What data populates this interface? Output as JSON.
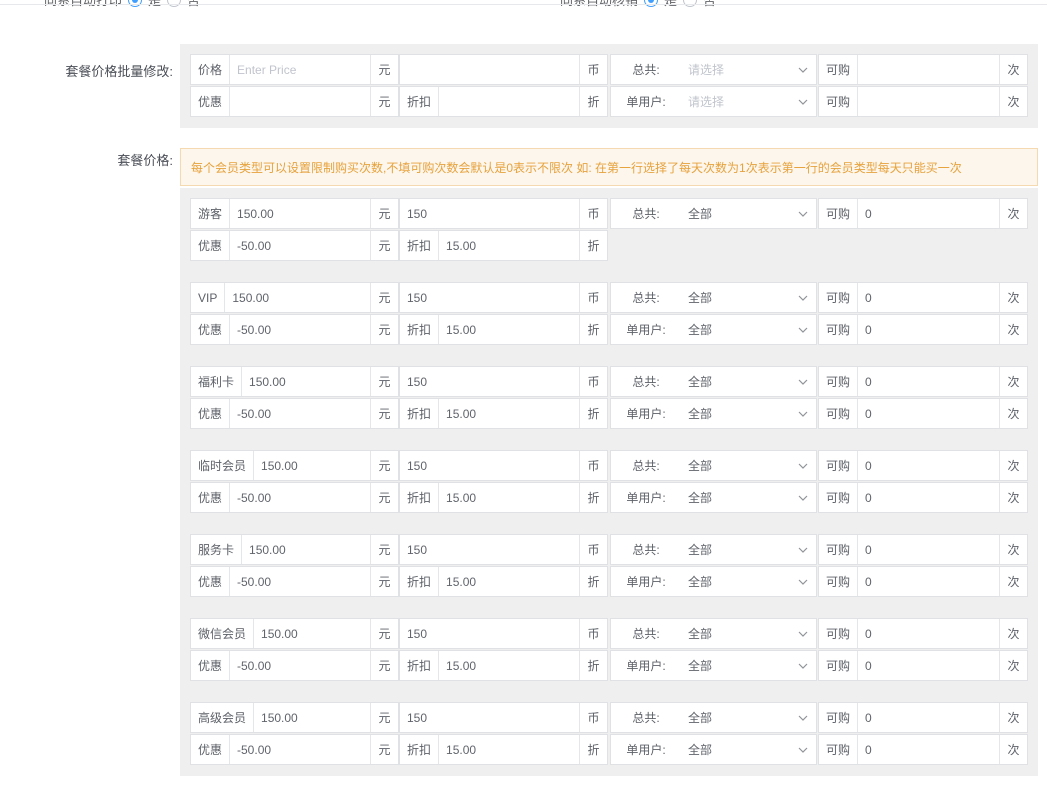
{
  "top": {
    "left_group_label": "同系自动打印",
    "left_yes": "是",
    "left_no": "否",
    "right_group_label": "同系自动核销",
    "right_yes": "是",
    "right_no": "否"
  },
  "batch": {
    "section_label": "套餐价格批量修改:",
    "price_prefix": "价格",
    "price_placeholder": "Enter Price",
    "yuan": "元",
    "coin_value": "",
    "coin_suffix": "币",
    "total_label": "总共:",
    "select_placeholder": "请选择",
    "can_buy_prefix": "可购",
    "can_buy_value": "",
    "times_suffix": "次",
    "discount_prefix": "优惠",
    "discount_value": "",
    "rebate_prefix": "折扣",
    "rebate_value": "",
    "rebate_suffix": "折",
    "per_user_label": "单用户:"
  },
  "pricing": {
    "section_label": "套餐价格:",
    "notice": "每个会员类型可以设置限制购买次数,不填可购次数会默认是0表示不限次 如: 在第一行选择了每天次数为1次表示第一行的会员类型每天只能买一次",
    "labels": {
      "yuan": "元",
      "coin": "币",
      "total": "总共:",
      "can_buy": "可购",
      "times": "次",
      "discount": "优惠",
      "rebate": "折扣",
      "rebate_suffix": "折",
      "per_user": "单用户:"
    },
    "members": [
      {
        "name": "游客",
        "price": "150.00",
        "coin": "150",
        "total": "全部",
        "can_buy": "0",
        "discount": "-50.00",
        "rebate": "15.00",
        "has_per_user": false,
        "per_user": "",
        "per_user_buy": ""
      },
      {
        "name": "VIP",
        "price": "150.00",
        "coin": "150",
        "total": "全部",
        "can_buy": "0",
        "discount": "-50.00",
        "rebate": "15.00",
        "has_per_user": true,
        "per_user": "全部",
        "per_user_buy": "0"
      },
      {
        "name": "福利卡",
        "price": "150.00",
        "coin": "150",
        "total": "全部",
        "can_buy": "0",
        "discount": "-50.00",
        "rebate": "15.00",
        "has_per_user": true,
        "per_user": "全部",
        "per_user_buy": "0"
      },
      {
        "name": "临时会员",
        "price": "150.00",
        "coin": "150",
        "total": "全部",
        "can_buy": "0",
        "discount": "-50.00",
        "rebate": "15.00",
        "has_per_user": true,
        "per_user": "全部",
        "per_user_buy": "0"
      },
      {
        "name": "服务卡",
        "price": "150.00",
        "coin": "150",
        "total": "全部",
        "can_buy": "0",
        "discount": "-50.00",
        "rebate": "15.00",
        "has_per_user": true,
        "per_user": "全部",
        "per_user_buy": "0"
      },
      {
        "name": "微信会员",
        "price": "150.00",
        "coin": "150",
        "total": "全部",
        "can_buy": "0",
        "discount": "-50.00",
        "rebate": "15.00",
        "has_per_user": true,
        "per_user": "全部",
        "per_user_buy": "0"
      },
      {
        "name": "高级会员",
        "price": "150.00",
        "coin": "150",
        "total": "全部",
        "can_buy": "0",
        "discount": "-50.00",
        "rebate": "15.00",
        "has_per_user": true,
        "per_user": "全部",
        "per_user_buy": "0"
      }
    ]
  }
}
